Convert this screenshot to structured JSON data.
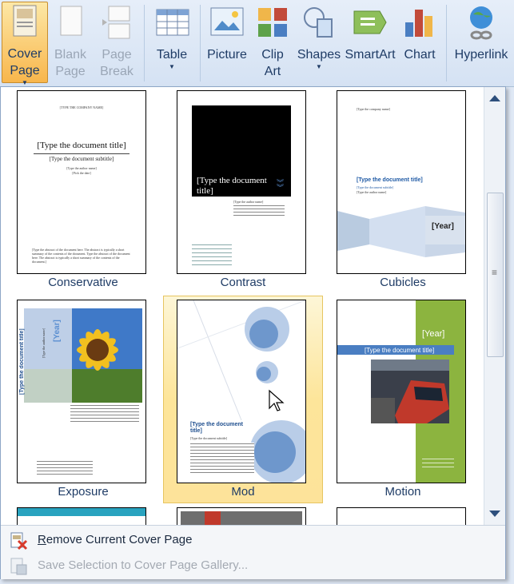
{
  "ribbon": {
    "buttons": [
      {
        "id": "cover",
        "label1": "Cover",
        "label2": "Page",
        "icon": "cover-page-icon",
        "state": "active"
      },
      {
        "id": "blank",
        "label1": "Blank",
        "label2": "Page",
        "icon": "blank-page-icon",
        "state": "disabled"
      },
      {
        "id": "break",
        "label1": "Page",
        "label2": "Break",
        "icon": "page-break-icon",
        "state": "disabled"
      },
      {
        "id": "table",
        "label1": "Table",
        "label2": "",
        "icon": "table-icon",
        "state": "normal"
      },
      {
        "id": "picture",
        "label1": "Picture",
        "label2": "",
        "icon": "picture-icon",
        "state": "normal"
      },
      {
        "id": "clipart",
        "label1": "Clip",
        "label2": "Art",
        "icon": "clip-art-icon",
        "state": "normal"
      },
      {
        "id": "shapes",
        "label1": "Shapes",
        "label2": "",
        "icon": "shapes-icon",
        "state": "normal"
      },
      {
        "id": "smartart",
        "label1": "SmartArt",
        "label2": "",
        "icon": "smartart-icon",
        "state": "normal"
      },
      {
        "id": "chart",
        "label1": "Chart",
        "label2": "",
        "icon": "chart-icon",
        "state": "normal"
      },
      {
        "id": "hyperlink",
        "label1": "Hyperlink",
        "label2": "",
        "icon": "hyperlink-icon",
        "state": "normal"
      }
    ]
  },
  "gallery": {
    "items": [
      {
        "name": "Conservative",
        "t_company": "[TYPE THE COMPANY NAME]",
        "t_title": "[Type the document title]",
        "t_subtitle": "[Type the document subtitle]",
        "t_author": "[Type the author name]",
        "t_date": "[Pick the date]",
        "t_abstract": "[Type the abstract of the document here. The abstract is typically a short summary of the contents of the document. Type the abstract of the document here. The abstract is typically a short summary of the contents of the document.]"
      },
      {
        "name": "Contrast",
        "t_title": "[Type the document title]",
        "t_author": "[Type the author name]"
      },
      {
        "name": "Cubicles",
        "t_company": "[Type the company name]",
        "t_title": "[Type the document title]",
        "t_subtitle": "[Type the document subtitle]",
        "t_author": "[Type the author name]",
        "t_year": "[Year]"
      },
      {
        "name": "Exposure",
        "t_title": "[Type the document title]",
        "t_author": "[Type the author name]",
        "t_year": "[Year]"
      },
      {
        "name": "Mod",
        "t_title": "[Type the document title]",
        "t_subtitle": "[Type the document subtitle]"
      },
      {
        "name": "Motion",
        "t_year": "[Year]",
        "t_title": "[Type the document title]"
      }
    ]
  },
  "footer": {
    "remove_label_first": "R",
    "remove_label_rest": "emove Current Cover Page",
    "save_label": "Save Selection to Cover Page Gallery..."
  },
  "colors": {
    "accent": "#1f3c66",
    "highlight": "#fde59a",
    "motion_green": "#8cb43f",
    "cubicles_blue": "#1f5aa5"
  }
}
